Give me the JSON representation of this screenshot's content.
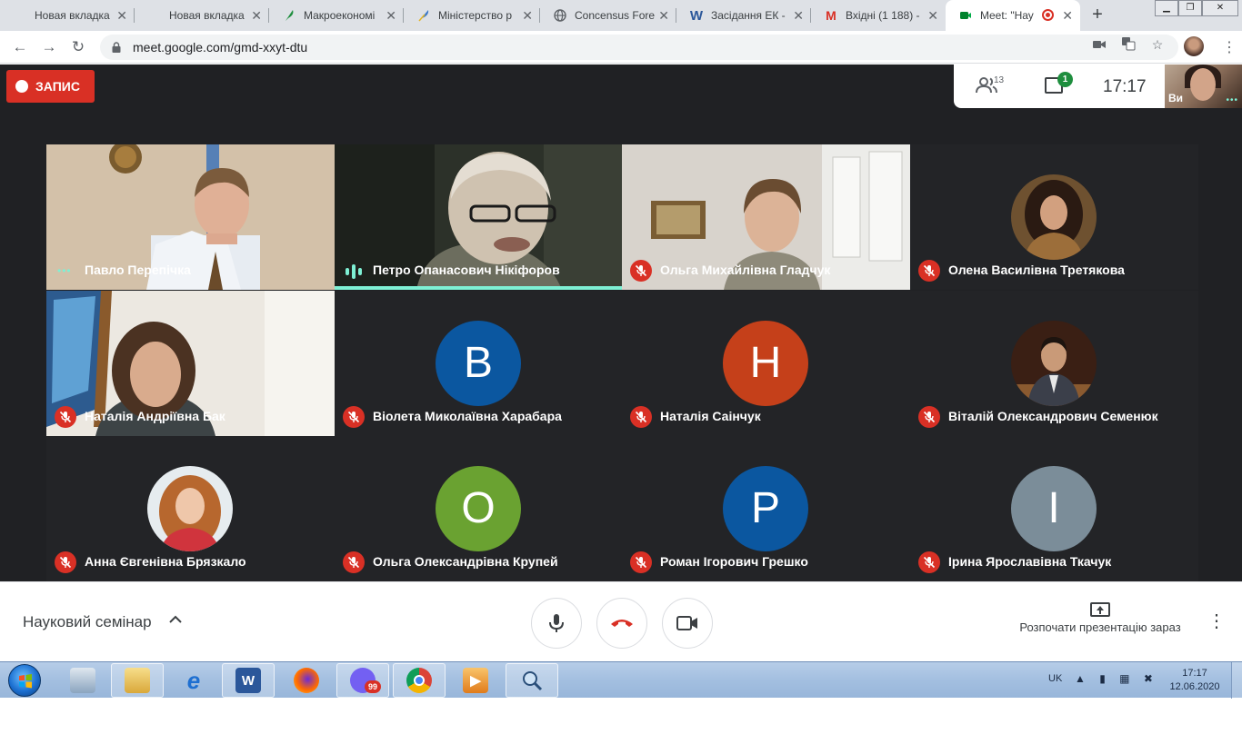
{
  "browser": {
    "tabs": [
      {
        "title": "Новая вкладка",
        "icon": "blank-page-icon"
      },
      {
        "title": "Новая вкладка",
        "icon": "blank-page-icon"
      },
      {
        "title": "Макроекономі",
        "icon": "feather-icon"
      },
      {
        "title": "Міністерство р",
        "icon": "feather-icon"
      },
      {
        "title": "Concensus Fore",
        "icon": "globe-icon"
      },
      {
        "title": "Засідання ЕК -",
        "icon": "word-icon"
      },
      {
        "title": "Вхідні (1 188) -",
        "icon": "gmail-icon"
      },
      {
        "title": "Meet: \"Нау",
        "icon": "meet-icon",
        "active": true
      }
    ],
    "url": "meet.google.com/gmd-xxyt-dtu"
  },
  "meet": {
    "recording_label": "ЗАПИС",
    "participants_count": "13",
    "chat_unread": "1",
    "time": "17:17",
    "self_label": "Ви",
    "tiles": [
      {
        "name": "Павло Перепічка",
        "status": "dots"
      },
      {
        "name": "Петро Опанасович Нікіфоров",
        "status": "speaking"
      },
      {
        "name": "Ольга Михайлівна Гладчук",
        "status": "muted"
      },
      {
        "name": "Олена Василівна Третякова",
        "status": "muted"
      },
      {
        "name": "Наталія Андріївна Бак",
        "status": "muted"
      },
      {
        "name": "Віолета Миколаївна Харабара",
        "status": "muted",
        "initial": "В"
      },
      {
        "name": "Наталія Саінчук",
        "status": "muted",
        "initial": "Н"
      },
      {
        "name": "Віталій Олександрович Семенюк",
        "status": "muted"
      },
      {
        "name": "Анна Євгенівна Брязкало",
        "status": "muted"
      },
      {
        "name": "Ольга Олександрівна Крупей",
        "status": "muted",
        "initial": "О"
      },
      {
        "name": "Роман Ігорович Грешко",
        "status": "muted",
        "initial": "Р"
      },
      {
        "name": "Ірина Ярославівна Ткачук",
        "status": "muted",
        "initial": "І"
      }
    ],
    "colors": {
      "avatar_blue": "#0b57a0",
      "avatar_orange": "#c5401a",
      "avatar_green": "#6aa231",
      "avatar_grey": "#7b8d99",
      "muted_red": "#d93025",
      "speaking_teal": "#7ef0d4"
    },
    "meeting_title": "Науковий семінар",
    "present_label": "Розпочати презентацію зараз"
  },
  "taskbar": {
    "apps": [
      "explorer",
      "internet-explorer",
      "word",
      "firefox",
      "viber",
      "chrome",
      "media-player",
      "search-tool"
    ],
    "viber_badge": "99",
    "language": "UK",
    "clock_time": "17:17",
    "clock_date": "12.06.2020"
  }
}
